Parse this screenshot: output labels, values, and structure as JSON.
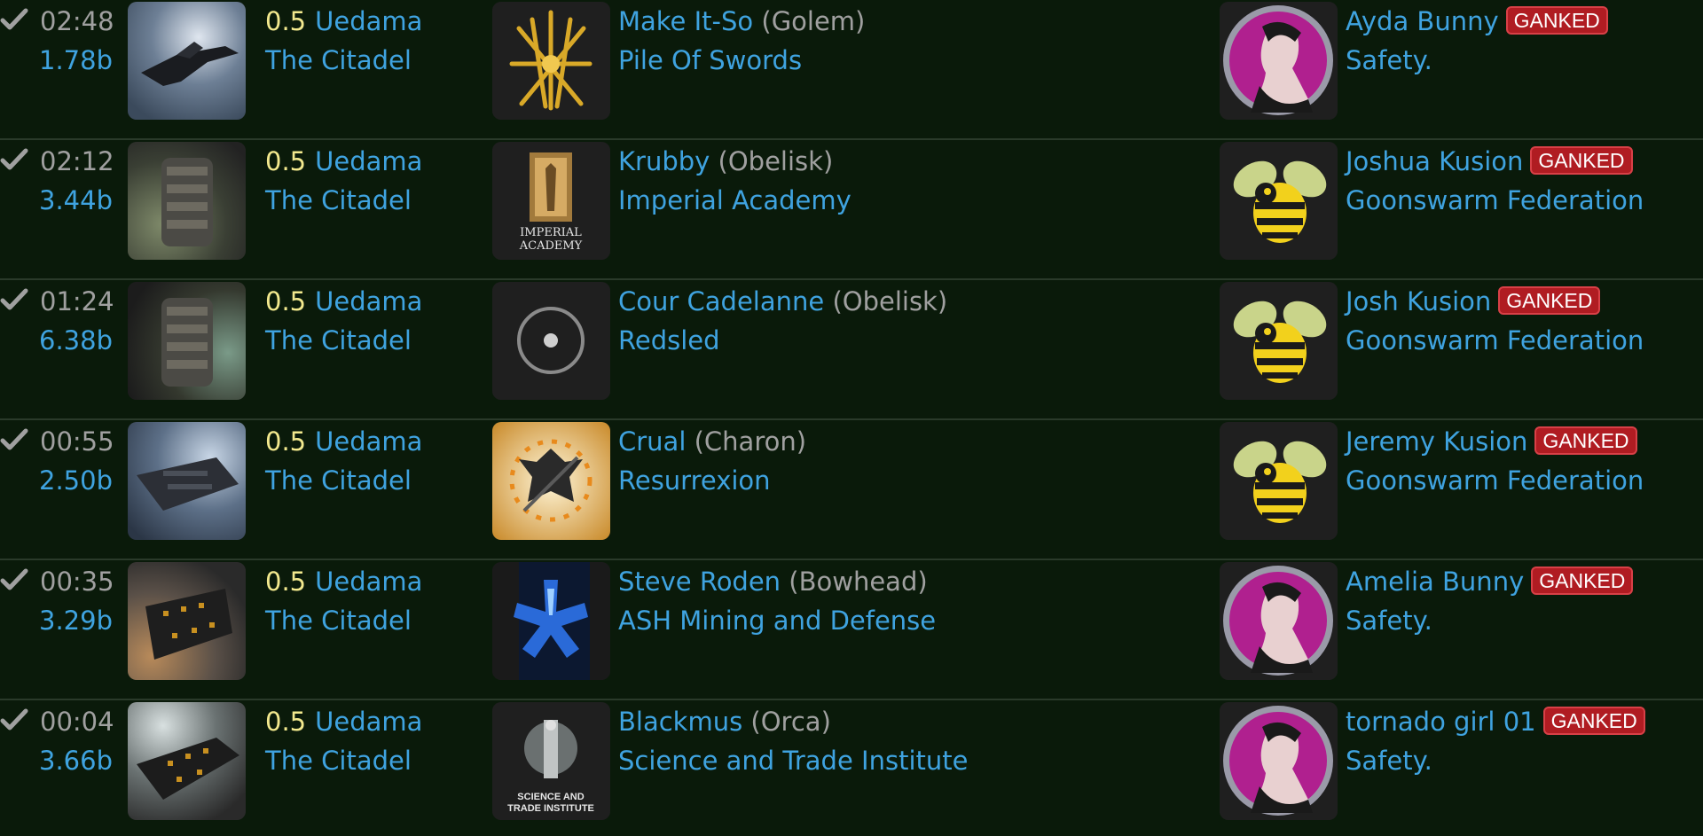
{
  "colors": {
    "background": "#0a1a0a",
    "link": "#3fa3e0",
    "muted": "#a0a0a0",
    "security": "#f3e98e",
    "badge": "#b01c22"
  },
  "kills": [
    {
      "time": "02:48",
      "value": "1.78b",
      "security": "0.5",
      "system": "Uedama",
      "region": "The Citadel",
      "attacker_name": "Make It-So",
      "attacker_ship": "(Golem)",
      "attacker_corp": "Pile Of Swords",
      "victim_name": "Ayda Bunny",
      "badge": "GANKED",
      "victim_corp": "Safety."
    },
    {
      "time": "02:12",
      "value": "3.44b",
      "security": "0.5",
      "system": "Uedama",
      "region": "The Citadel",
      "attacker_name": "Krubby",
      "attacker_ship": "(Obelisk)",
      "attacker_corp": "Imperial Academy",
      "victim_name": "Joshua Kusion",
      "badge": "GANKED",
      "victim_corp": "Goonswarm Federation",
      "corp_logo_text": [
        "IMPERIAL",
        "ACADEMY"
      ]
    },
    {
      "time": "01:24",
      "value": "6.38b",
      "security": "0.5",
      "system": "Uedama",
      "region": "The Citadel",
      "attacker_name": "Cour Cadelanne",
      "attacker_ship": "(Obelisk)",
      "attacker_corp": "Redsled",
      "victim_name": "Josh Kusion",
      "badge": "GANKED",
      "victim_corp": "Goonswarm Federation"
    },
    {
      "time": "00:55",
      "value": "2.50b",
      "security": "0.5",
      "system": "Uedama",
      "region": "The Citadel",
      "attacker_name": "Crual",
      "attacker_ship": "(Charon)",
      "attacker_corp": "Resurrexion",
      "victim_name": "Jeremy Kusion",
      "badge": "GANKED",
      "victim_corp": "Goonswarm Federation"
    },
    {
      "time": "00:35",
      "value": "3.29b",
      "security": "0.5",
      "system": "Uedama",
      "region": "The Citadel",
      "attacker_name": "Steve Roden",
      "attacker_ship": "(Bowhead)",
      "attacker_corp": "ASH Mining and Defense",
      "victim_name": "Amelia Bunny",
      "badge": "GANKED",
      "victim_corp": "Safety."
    },
    {
      "time": "00:04",
      "value": "3.66b",
      "security": "0.5",
      "system": "Uedama",
      "region": "The Citadel",
      "attacker_name": "Blackmus",
      "attacker_ship": "(Orca)",
      "attacker_corp": "Science and Trade Institute",
      "victim_name": "tornado girl 01",
      "badge": "GANKED",
      "victim_corp": "Safety.",
      "corp_logo_text": [
        "SCIENCE AND",
        "TRADE INSTITUTE"
      ]
    }
  ]
}
